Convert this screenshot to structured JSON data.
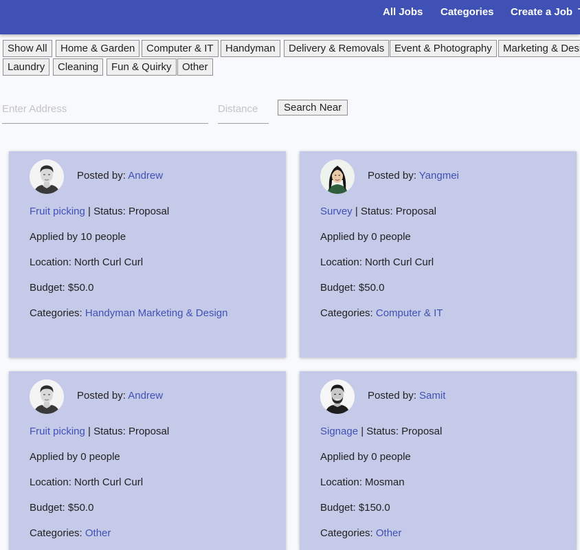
{
  "nav": {
    "all_jobs": "All Jobs",
    "categories": "Categories",
    "create_job": "Create a Job"
  },
  "filters": [
    "Show All",
    "Home & Garden",
    "Computer & IT",
    "Handyman",
    "Delivery & Removals",
    "Event & Photography",
    "Marketing & Design",
    "Laundry",
    "Cleaning",
    "Fun & Quirky",
    "Other"
  ],
  "search": {
    "address_placeholder": "Enter Address",
    "distance_placeholder": "Distance",
    "button": "Search Near"
  },
  "labels": {
    "posted_by": "Posted by: ",
    "status_sep": " | Status: ",
    "applied_prefix": "Applied by ",
    "applied_suffix": " people",
    "location": "Location: ",
    "budget": "Budget: ",
    "categories": "Categories: "
  },
  "jobs": [
    {
      "poster": "Andrew",
      "title": "Fruit picking",
      "status": "Proposal",
      "applied": "10",
      "location": "North Curl Curl",
      "budget": "$50.0",
      "categories": "Handyman Marketing & Design"
    },
    {
      "poster": "Yangmei",
      "title": "Survey",
      "status": "Proposal",
      "applied": "0",
      "location": "North Curl Curl",
      "budget": "$50.0",
      "categories": "Computer & IT"
    },
    {
      "poster": "Andrew",
      "title": "Fruit picking",
      "status": "Proposal",
      "applied": "0",
      "location": "North Curl Curl",
      "budget": "$50.0",
      "categories": "Other"
    },
    {
      "poster": "Samit",
      "title": "Signage",
      "status": "Proposal",
      "applied": "0",
      "location": "Mosman",
      "budget": "$150.0",
      "categories": "Other"
    }
  ],
  "colors": {
    "primary": "#3f51b5",
    "card": "#c5cae9"
  }
}
